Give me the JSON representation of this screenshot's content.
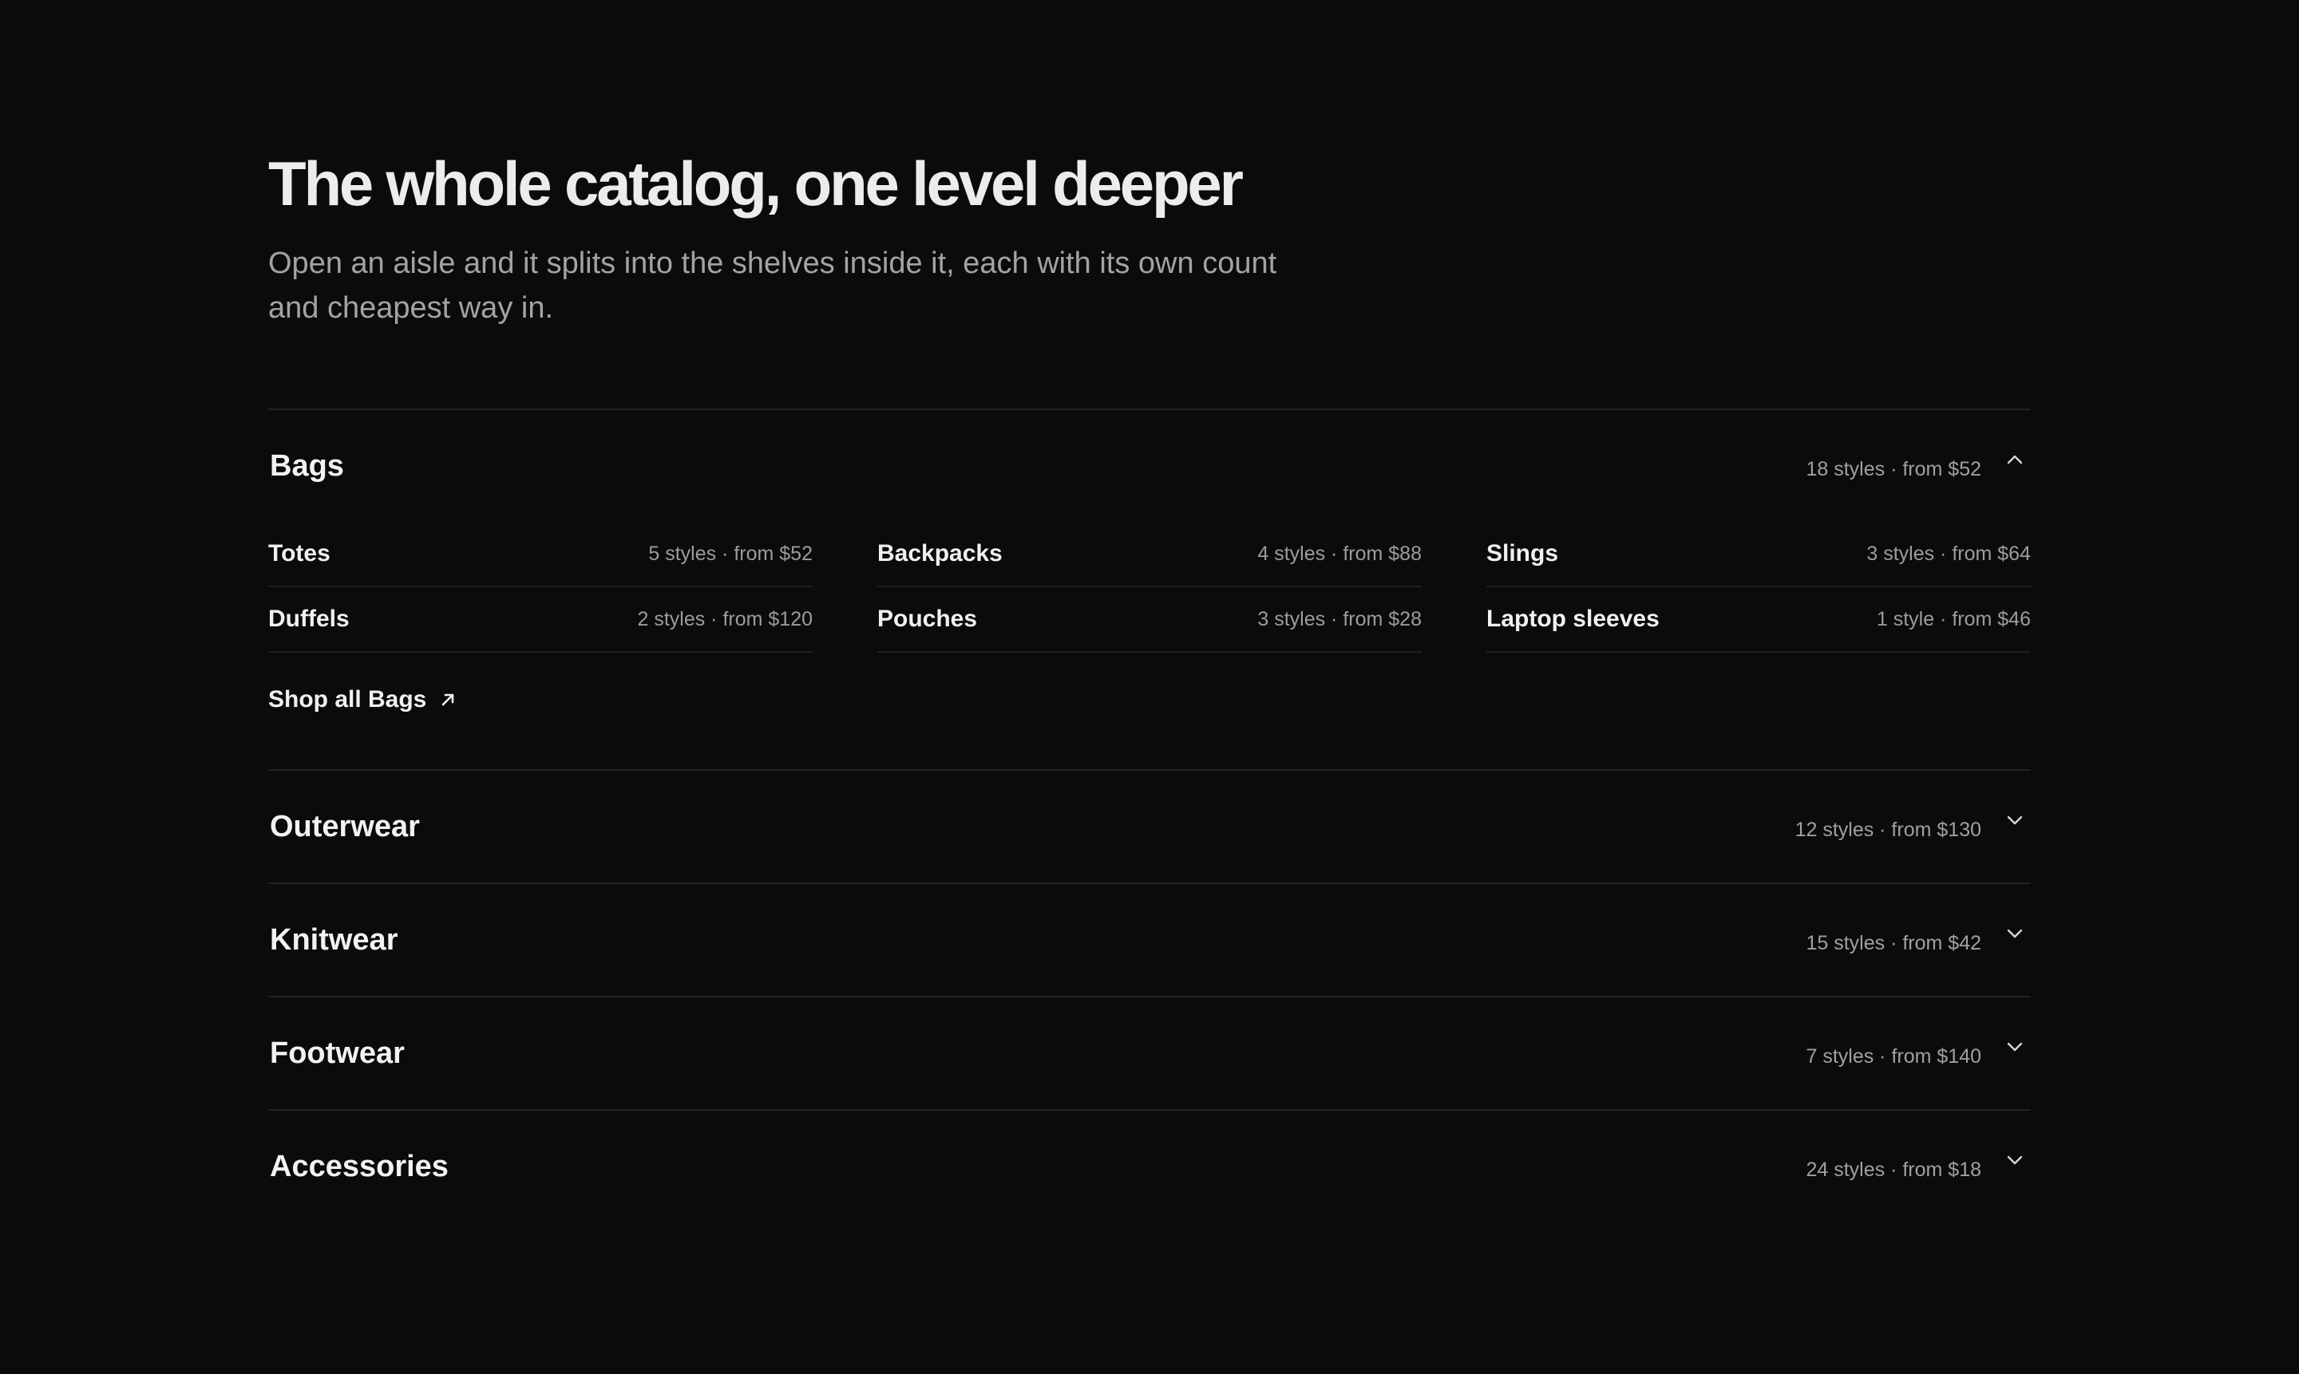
{
  "hero": {
    "title": "The whole catalog, one level deeper",
    "subtitle": "Open an aisle and it splits into the shelves inside it, each with its own count and cheapest way in."
  },
  "sections": [
    {
      "title": "Bags",
      "meta": "18 styles · from $52",
      "expanded": true,
      "icon": "chevron-up-icon",
      "shelves": [
        {
          "name": "Totes",
          "meta": "5 styles · from $52"
        },
        {
          "name": "Backpacks",
          "meta": "4 styles · from $88"
        },
        {
          "name": "Slings",
          "meta": "3 styles · from $64"
        },
        {
          "name": "Duffels",
          "meta": "2 styles · from $120"
        },
        {
          "name": "Pouches",
          "meta": "3 styles · from $28"
        },
        {
          "name": "Laptop sleeves",
          "meta": "1 style · from $46"
        }
      ],
      "shop_all_label": "Shop all Bags",
      "shop_all_icon": "arrow-up-right-icon"
    },
    {
      "title": "Outerwear",
      "meta": "12 styles · from $130",
      "expanded": false,
      "icon": "chevron-down-icon"
    },
    {
      "title": "Knitwear",
      "meta": "15 styles · from $42",
      "expanded": false,
      "icon": "chevron-down-icon"
    },
    {
      "title": "Footwear",
      "meta": "7 styles · from $140",
      "expanded": false,
      "icon": "chevron-down-icon"
    },
    {
      "title": "Accessories",
      "meta": "24 styles · from $18",
      "expanded": false,
      "icon": "chevron-down-icon"
    }
  ],
  "colors": {
    "background": "#0b0b0b",
    "text": "#ededed",
    "muted": "#a0a0a0",
    "divider": "#222222"
  }
}
